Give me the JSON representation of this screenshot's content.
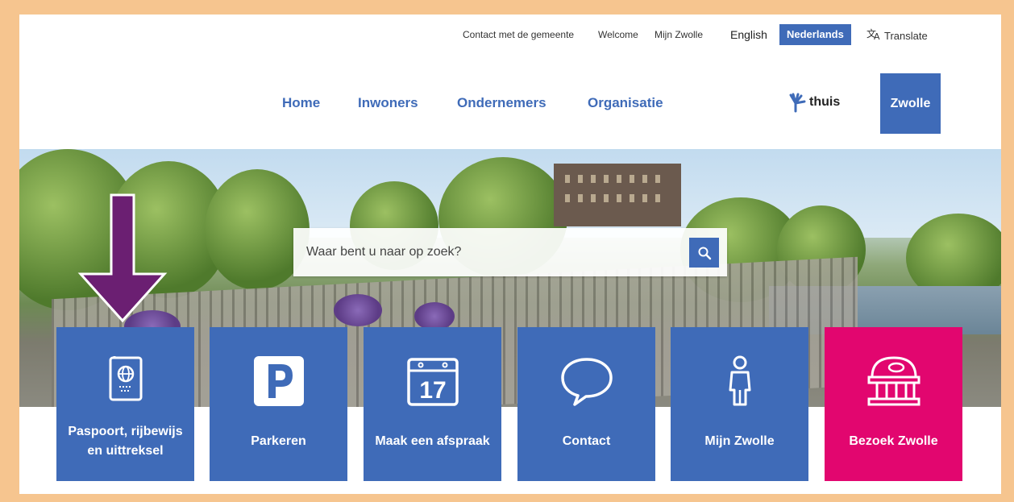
{
  "utility": {
    "contact": "Contact met de gemeente",
    "welcome": "Welcome",
    "mijn_zwolle": "Mijn Zwolle",
    "lang_english": "English",
    "lang_dutch": "Nederlands",
    "translate": "Translate"
  },
  "nav": {
    "items": [
      "Home",
      "Inwoners",
      "Ondernemers",
      "Organisatie"
    ],
    "thuis": "thuis",
    "logo": "Zwolle"
  },
  "search": {
    "placeholder": "Waar bent u naar op zoek?"
  },
  "tiles": [
    {
      "label": "Paspoort, rijbewijs en uittreksel",
      "icon": "passport-icon"
    },
    {
      "label": "Parkeren",
      "icon": "parking-icon"
    },
    {
      "label": "Maak een afspraak",
      "icon": "calendar-icon",
      "calendar_day": "17"
    },
    {
      "label": "Contact",
      "icon": "speech-bubble-icon"
    },
    {
      "label": "Mijn Zwolle",
      "icon": "person-icon"
    },
    {
      "label": "Bezoek Zwolle",
      "icon": "museum-icon"
    }
  ],
  "colors": {
    "brand_blue": "#3f6bb8",
    "visit_pink": "#e2066f",
    "arrow_purple": "#6b1f72",
    "border_orange": "#f6c58f"
  }
}
